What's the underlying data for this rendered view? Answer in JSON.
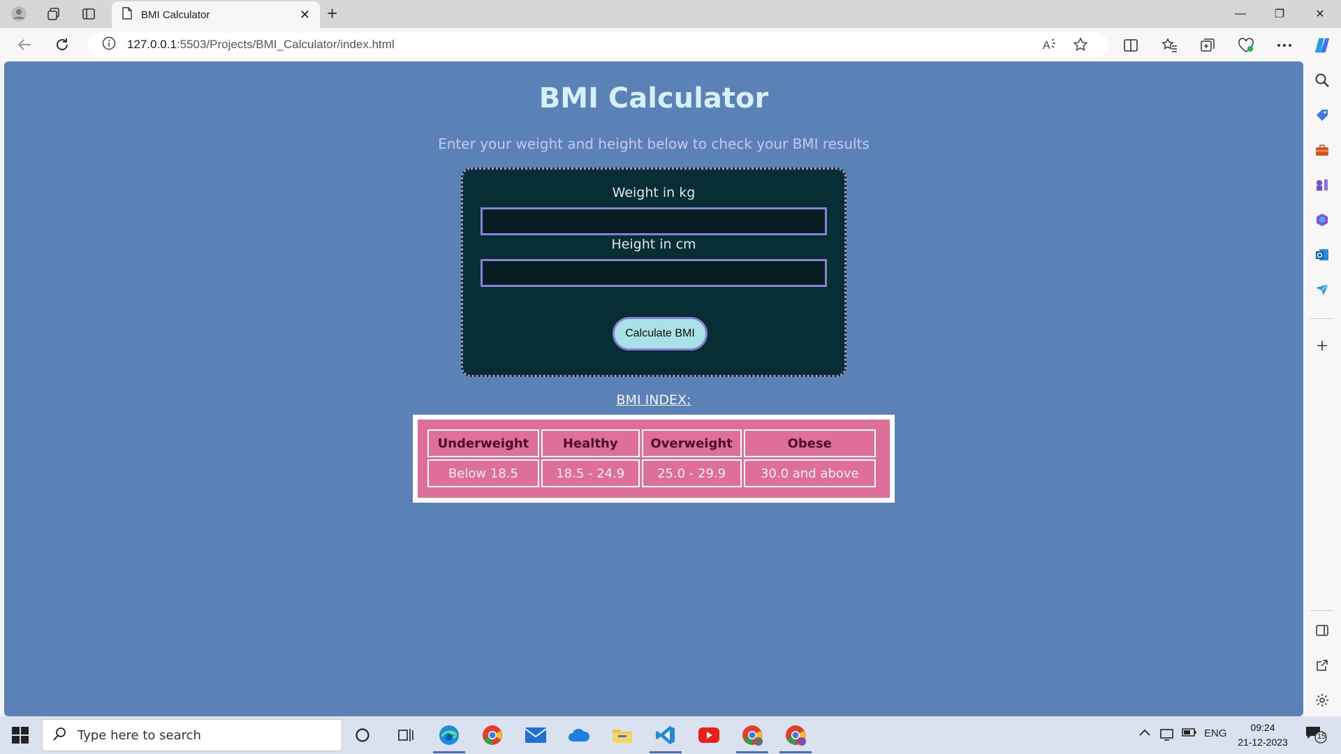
{
  "browser": {
    "tab_title": "BMI Calculator",
    "tab_close": "✕",
    "new_tab": "+",
    "url_host": "127.0.0.1",
    "url_path": ":5503/Projects/BMI_Calculator/index.html",
    "window_controls": {
      "minimize": "—",
      "restore": "❐",
      "close": "✕"
    }
  },
  "page": {
    "title": "BMI Calculator",
    "subtitle": "Enter your weight and height below to check your BMI results",
    "weight_label": "Weight in kg",
    "height_label": "Height in cm",
    "weight_value": "",
    "height_value": "",
    "button_label": "Calculate BMI",
    "index_label": "BMI INDEX:",
    "table": {
      "headers": [
        "Underweight",
        "Healthy",
        "Overweight",
        "Obese"
      ],
      "ranges": [
        "Below 18.5",
        "18.5 - 24.9",
        "25.0 - 29.9",
        "30.0 and above"
      ]
    }
  },
  "taskbar": {
    "search_placeholder": "Type here to search",
    "language": "ENG",
    "time": "09:24",
    "date": "21-12-2023",
    "notification_count": "15"
  },
  "colors": {
    "page_bg": "#5b82b7",
    "form_bg": "#072e34",
    "table_bg": "#dd6f9a",
    "button_bg": "#a8e1e6"
  }
}
